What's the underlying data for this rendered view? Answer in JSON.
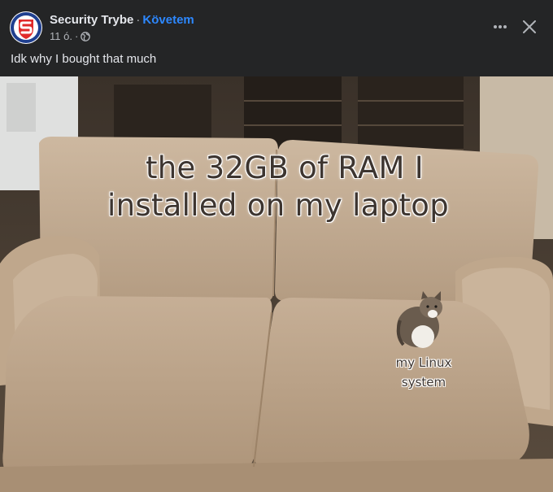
{
  "post": {
    "page_name": "Security Trybe",
    "separator": "·",
    "follow_label": "Követem",
    "time": "11 ó.",
    "meta_separator": "·",
    "audience_icon": "globe-icon",
    "text": "Idk why I bought that much"
  },
  "actions": {
    "more_icon": "more-dots-icon",
    "close_icon": "close-icon"
  },
  "meme": {
    "top_caption_line1": "the 32GB of RAM I",
    "top_caption_line2": "installed on my laptop",
    "cat_caption_line1": "my Linux",
    "cat_caption_line2": "system"
  },
  "colors": {
    "background": "#242526",
    "accent": "#2d88ff",
    "logo_red": "#e02a2a",
    "logo_blue": "#1f3f8f"
  }
}
